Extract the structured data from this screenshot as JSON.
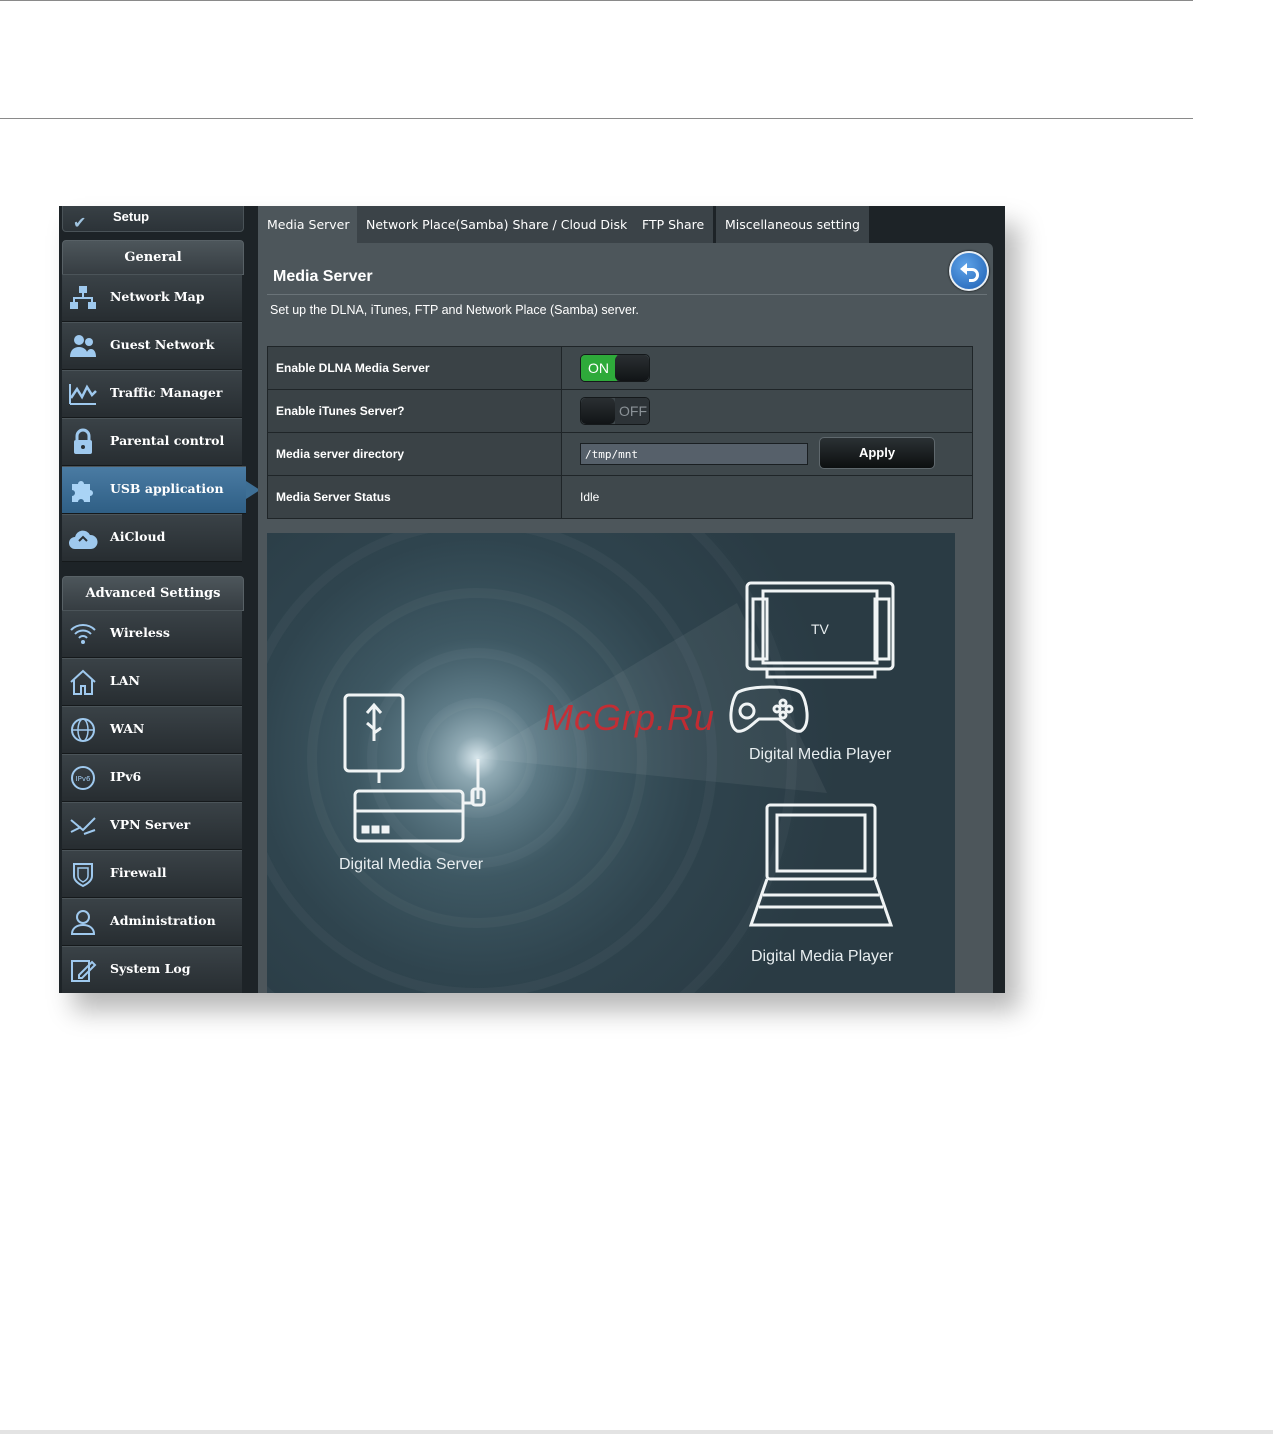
{
  "sidebar": {
    "setup_label": "Setup",
    "general_title": "General",
    "general_items": [
      {
        "label": "Network Map",
        "icon": "network-map-icon"
      },
      {
        "label": "Guest Network",
        "icon": "guest-network-icon"
      },
      {
        "label": "Traffic Manager",
        "icon": "traffic-manager-icon"
      },
      {
        "label": "Parental control",
        "icon": "lock-icon"
      },
      {
        "label": "USB application",
        "icon": "puzzle-icon",
        "active": true
      },
      {
        "label": "AiCloud",
        "icon": "cloud-icon"
      }
    ],
    "advanced_title": "Advanced Settings",
    "advanced_items": [
      {
        "label": "Wireless",
        "icon": "wifi-icon"
      },
      {
        "label": "LAN",
        "icon": "home-icon"
      },
      {
        "label": "WAN",
        "icon": "globe-icon"
      },
      {
        "label": "IPv6",
        "icon": "ipv6-icon"
      },
      {
        "label": "VPN Server",
        "icon": "vpn-icon"
      },
      {
        "label": "Firewall",
        "icon": "shield-icon"
      },
      {
        "label": "Administration",
        "icon": "user-icon"
      },
      {
        "label": "System Log",
        "icon": "edit-log-icon"
      }
    ]
  },
  "tabs": [
    {
      "label": "Media Server",
      "active": true
    },
    {
      "label": "Network Place(Samba) Share / Cloud Disk"
    },
    {
      "label": "FTP Share"
    },
    {
      "label": "Miscellaneous setting"
    }
  ],
  "panel": {
    "title": "Media Server",
    "description": "Set up the DLNA, iTunes, FTP and Network Place (Samba) server."
  },
  "settings": {
    "dlna_label": "Enable DLNA Media Server",
    "dlna_state": "ON",
    "itunes_label": "Enable iTunes Server?",
    "itunes_state": "OFF",
    "directory_label": "Media server directory",
    "directory_value": "/tmp/mnt",
    "apply_label": "Apply",
    "status_label": "Media Server Status",
    "status_value": "Idle"
  },
  "illustration": {
    "tv_label": "TV",
    "player_label_1": "Digital  Media Player",
    "server_label": "Digital  Media Server",
    "player_label_2": "Digital  Media Player"
  },
  "watermark": "McGrp.Ru",
  "colors": {
    "toggle_on": "#2eaa3a",
    "active_nav": "#3e6f95",
    "back_button": "#1d5fb3"
  }
}
